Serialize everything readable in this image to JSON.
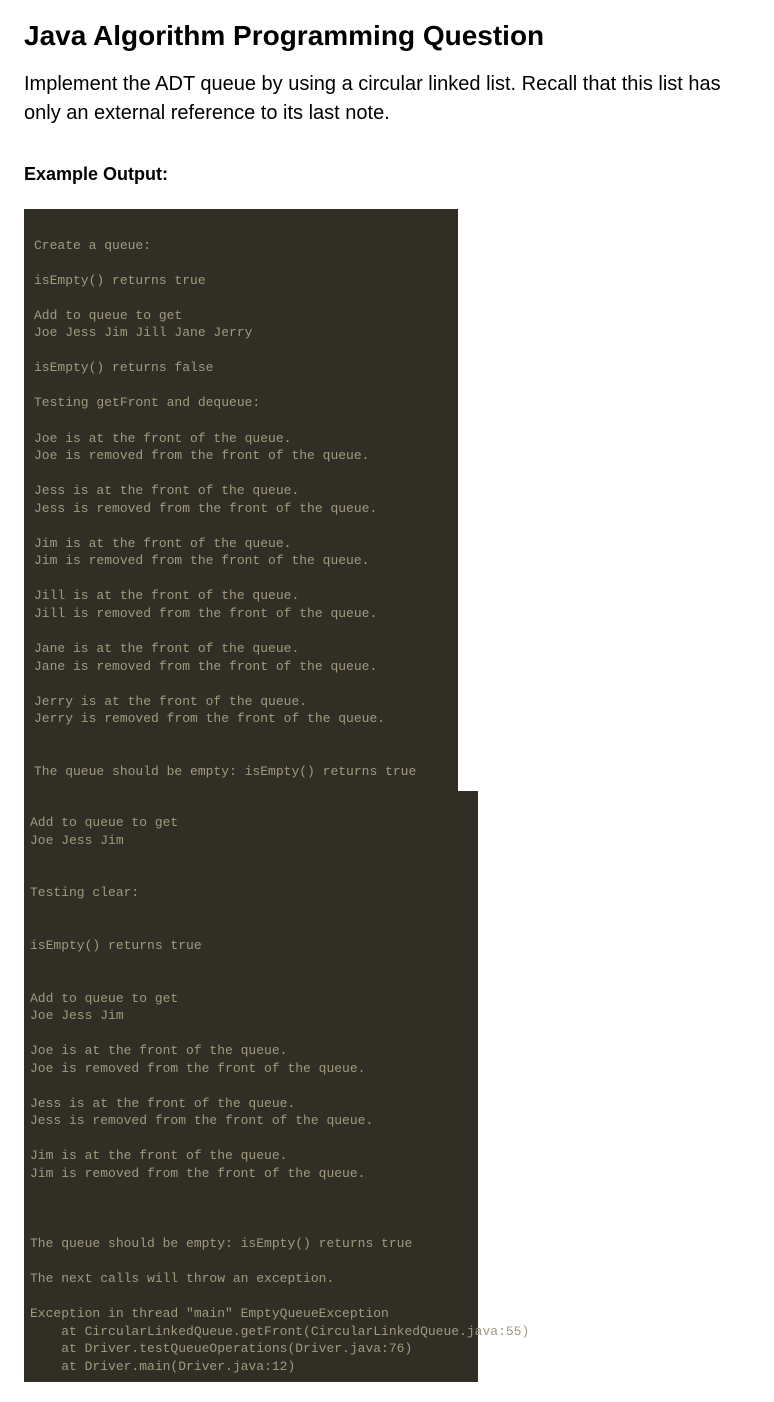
{
  "title": "Java Algorithm Programming Question",
  "description": "Implement the ADT queue by using a circular linked list. Recall that this list has only an external reference to its last note.",
  "example_label": "Example Output:",
  "console_output_1": "\nCreate a queue:\n\nisEmpty() returns true\n\nAdd to queue to get\nJoe Jess Jim Jill Jane Jerry\n\nisEmpty() returns false\n\nTesting getFront and dequeue:\n\nJoe is at the front of the queue.\nJoe is removed from the front of the queue.\n\nJess is at the front of the queue.\nJess is removed from the front of the queue.\n\nJim is at the front of the queue.\nJim is removed from the front of the queue.\n\nJill is at the front of the queue.\nJill is removed from the front of the queue.\n\nJane is at the front of the queue.\nJane is removed from the front of the queue.\n\nJerry is at the front of the queue.\nJerry is removed from the front of the queue.\n\n\nThe queue should be empty: isEmpty() returns true\n",
  "console_output_2": "\nAdd to queue to get\nJoe Jess Jim\n\n\nTesting clear:\n\n\nisEmpty() returns true\n\n\nAdd to queue to get\nJoe Jess Jim\n\nJoe is at the front of the queue.\nJoe is removed from the front of the queue.\n\nJess is at the front of the queue.\nJess is removed from the front of the queue.\n\nJim is at the front of the queue.\nJim is removed from the front of the queue.\n\n\n\nThe queue should be empty: isEmpty() returns true\n\nThe next calls will throw an exception.\n\nException in thread \"main\" EmptyQueueException\n    at CircularLinkedQueue.getFront(CircularLinkedQueue.java:55)\n    at Driver.testQueueOperations(Driver.java:76)\n    at Driver.main(Driver.java:12)"
}
